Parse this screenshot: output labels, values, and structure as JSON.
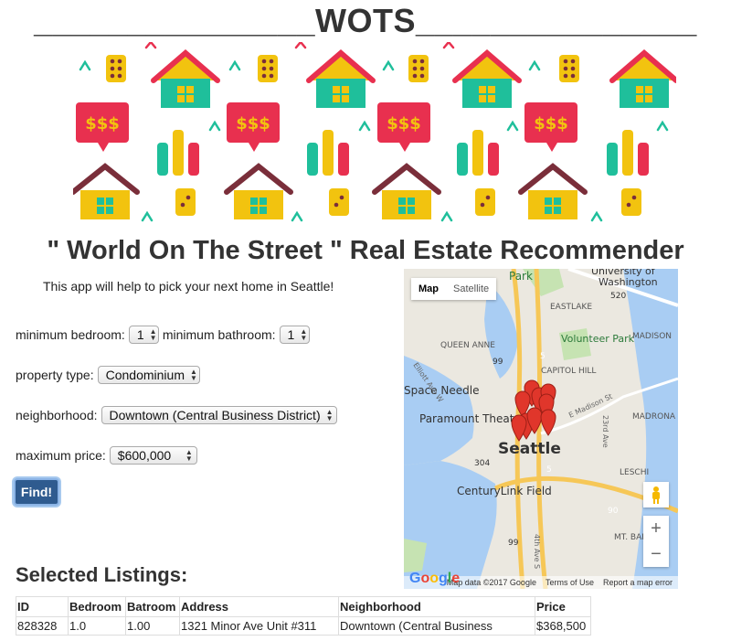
{
  "app": {
    "title": "_______________WOTS_______________",
    "subtitle": "\" World On The Street \" Real Estate Recommender",
    "intro": "This app will help to pick your next home in Seattle!"
  },
  "banner": {
    "sign_text": "$$$"
  },
  "form": {
    "min_bedroom_label": "minimum bedroom:",
    "min_bedroom_value": "1",
    "min_bathroom_label": "minimum bathroom:",
    "min_bathroom_value": "1",
    "property_type_label": "property type:",
    "property_type_value": "Condominium",
    "neighborhood_label": "neighborhood:",
    "neighborhood_value": "Downtown (Central Business District)",
    "max_price_label": "maximum price:",
    "max_price_value": "$600,000",
    "find_label": "Find!"
  },
  "map": {
    "tab_map": "Map",
    "tab_satellite": "Satellite",
    "zoom_in": "+",
    "zoom_out": "−",
    "google": "Google",
    "map_data": "Map data ©2017 Google",
    "terms": "Terms of Use",
    "report": "Report a map error",
    "labels": {
      "park": "Park",
      "university": "University of",
      "washington": "Washington",
      "eastlake": "EASTLAKE",
      "queen_anne": "QUEEN ANNE",
      "volunteer_park": "Volunteer Park",
      "capitol_hill": "CAPITOL HILL",
      "space_needle": "Space Needle",
      "paramount": "Paramount Theat",
      "madison": "MADISON",
      "madrona": "MADRONA",
      "seattle": "Seattle",
      "leschi": "LESCHI",
      "centurylink": "CenturyLink Field",
      "mt_baker": "MT. BAKER",
      "elliott": "Elliott Ave W",
      "e_madison": "E Madison St",
      "rd23": "23rd Ave",
      "ave4": "4th Ave S",
      "r520": "520",
      "r99a": "99",
      "r99b": "99",
      "r5a": "5",
      "r5b": "5",
      "r304": "304",
      "r90": "90"
    }
  },
  "listings": {
    "heading": "Selected Listings:",
    "columns": [
      "ID",
      "Bedroom",
      "Batroom",
      "Address",
      "Neighborhood",
      "Price"
    ],
    "rows": [
      [
        "828328",
        "1.0",
        "1.00",
        "1321 Minor Ave Unit #311",
        "Downtown (Central Business",
        "$368,500"
      ]
    ]
  }
}
